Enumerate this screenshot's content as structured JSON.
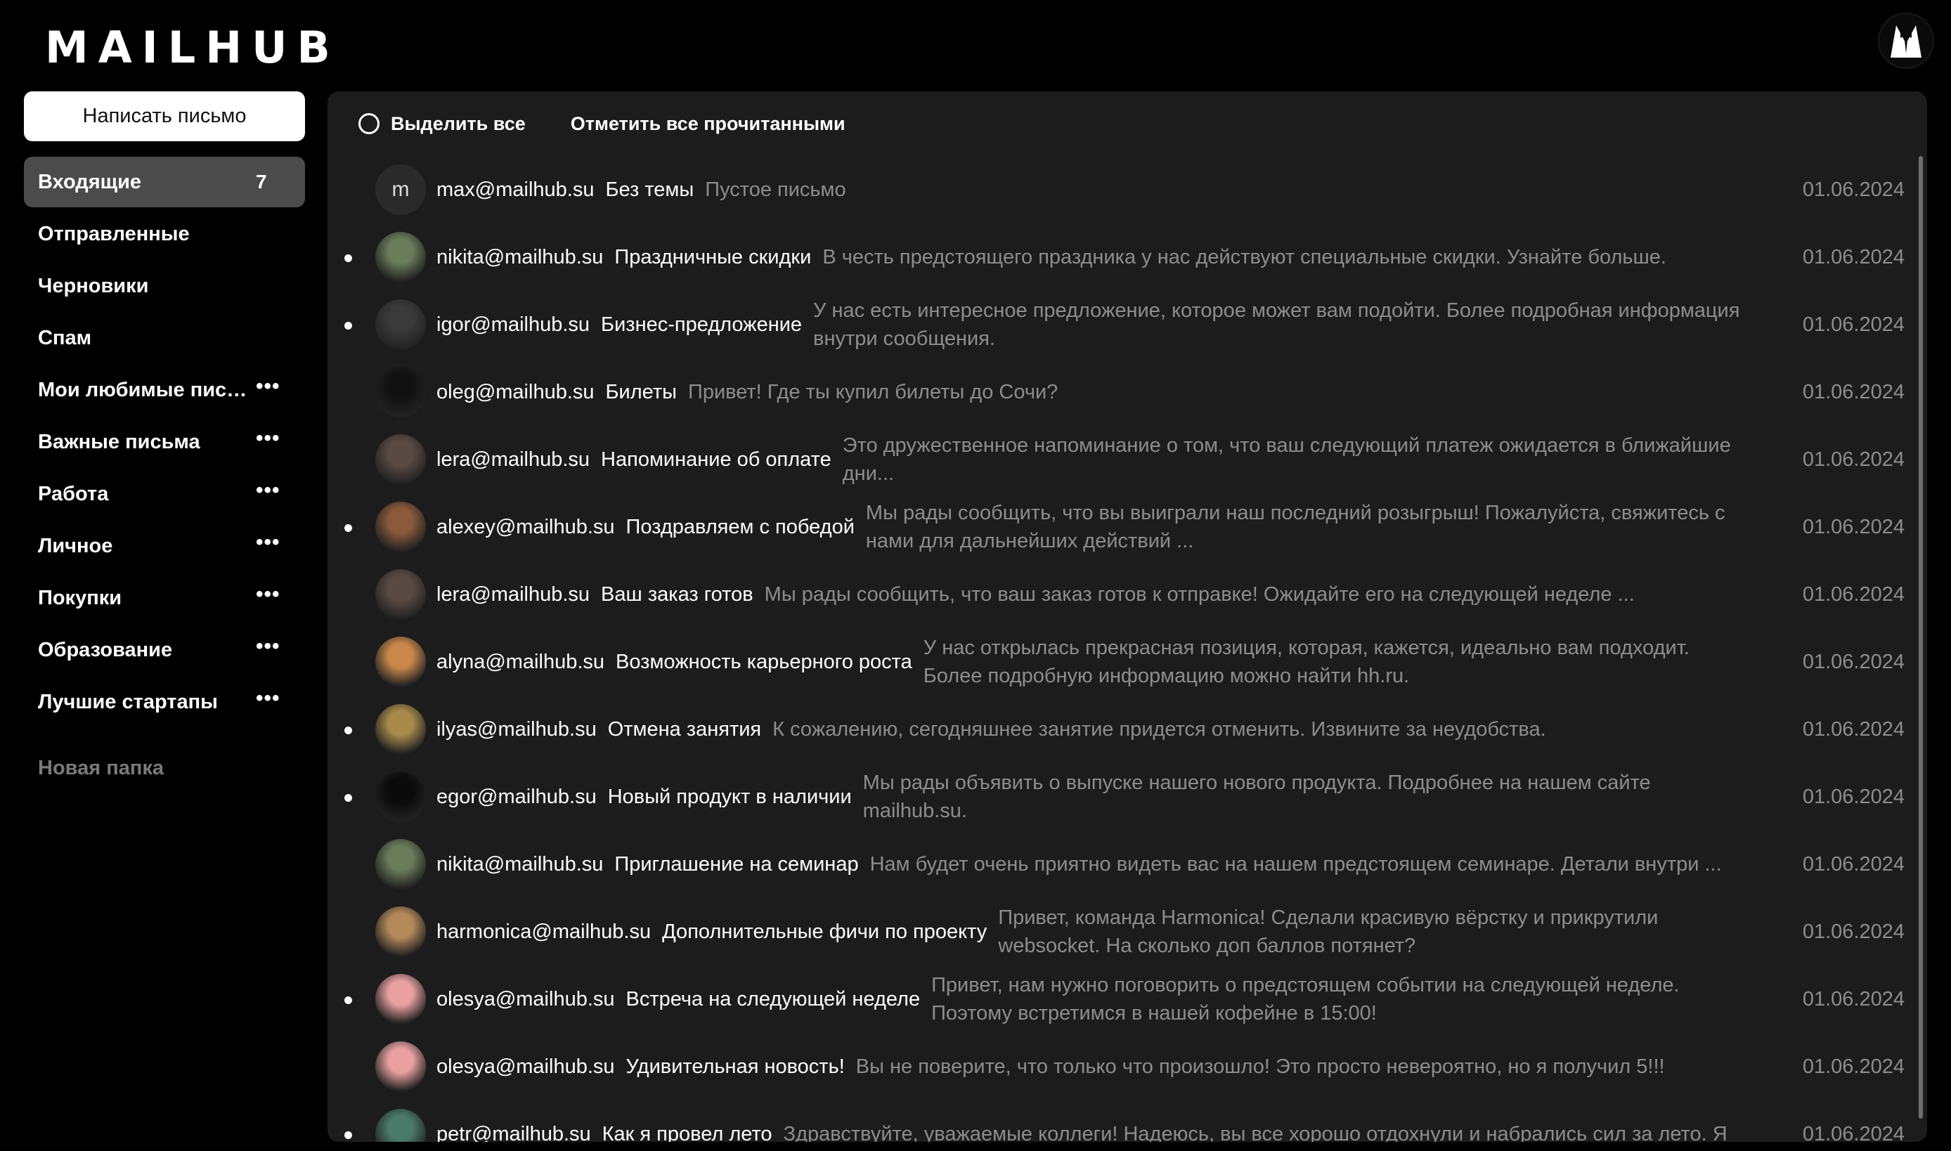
{
  "app": {
    "logo": "MAILHUB"
  },
  "sidebar": {
    "compose_label": "Написать письмо",
    "folders": [
      {
        "label": "Входящие",
        "count": "7"
      },
      {
        "label": "Отправленные"
      },
      {
        "label": "Черновики"
      },
      {
        "label": "Спам"
      },
      {
        "label": "Мои любимые пись...",
        "menu": "•••"
      },
      {
        "label": "Важные письма",
        "menu": "•••"
      },
      {
        "label": "Работа",
        "menu": "•••"
      },
      {
        "label": "Личное",
        "menu": "•••"
      },
      {
        "label": "Покупки",
        "menu": "•••"
      },
      {
        "label": "Образование",
        "menu": "•••"
      },
      {
        "label": "Лучшие стартапы",
        "menu": "•••"
      }
    ],
    "new_folder_label": "Новая папка"
  },
  "toolbar": {
    "select_all": "Выделить все",
    "mark_all_read": "Отметить все прочитанными"
  },
  "emails": [
    {
      "sender": "max@mailhub.su",
      "subject": "Без темы",
      "preview": "Пустое письмо",
      "date": "01.06.2024",
      "unread": false,
      "avatar_letter": "m",
      "avatar_color": "#2a2a2a"
    },
    {
      "sender": "nikita@mailhub.su",
      "subject": "Праздничные скидки",
      "preview": "В честь предстоящего праздника у нас действуют специальные скидки. Узнайте больше.",
      "date": "01.06.2024",
      "unread": true,
      "avatar_color": "#6b7c5a"
    },
    {
      "sender": "igor@mailhub.su",
      "subject": "Бизнес-предложение",
      "preview": "У нас есть интересное предложение, которое может вам подойти. Более подробная информация внутри сообщения.",
      "date": "01.06.2024",
      "unread": true,
      "avatar_color": "#3a3a3a"
    },
    {
      "sender": "oleg@mailhub.su",
      "subject": "Билеты",
      "preview": "Привет! Где ты купил билеты до Сочи?",
      "date": "01.06.2024",
      "unread": false,
      "avatar_color": "#111111"
    },
    {
      "sender": "lera@mailhub.su",
      "subject": "Напоминание об оплате",
      "preview": "Это дружественное напоминание о том, что ваш следующий платеж ожидается в ближайшие дни...",
      "date": "01.06.2024",
      "unread": false,
      "avatar_color": "#5a4a44"
    },
    {
      "sender": "alexey@mailhub.su",
      "subject": "Поздравляем с победой",
      "preview": "Мы рады сообщить, что вы выиграли наш последний розыгрыш! Пожалуйста, свяжитесь с нами для дальнейших действий ...",
      "date": "01.06.2024",
      "unread": true,
      "avatar_color": "#8a5a3a"
    },
    {
      "sender": "lera@mailhub.su",
      "subject": "Ваш заказ готов",
      "preview": "Мы рады сообщить, что ваш заказ готов к отправке! Ожидайте его на следующей неделе ...",
      "date": "01.06.2024",
      "unread": false,
      "avatar_color": "#5a4a44"
    },
    {
      "sender": "alyna@mailhub.su",
      "subject": "Возможность карьерного роста",
      "preview": "У нас открылась прекрасная позиция, которая, кажется, идеально вам подходит. Более подробную информацию можно найти hh.ru.",
      "date": "01.06.2024",
      "unread": false,
      "avatar_color": "#c9884a"
    },
    {
      "sender": "ilyas@mailhub.su",
      "subject": "Отмена занятия",
      "preview": "К сожалению, сегодняшнее занятие придется отменить. Извините за неудобства.",
      "date": "01.06.2024",
      "unread": true,
      "avatar_color": "#a88a4a"
    },
    {
      "sender": "egor@mailhub.su",
      "subject": "Новый продукт в наличии",
      "preview": "Мы рады объявить о выпуске нашего нового продукта. Подробнее на нашем сайте mailhub.su.",
      "date": "01.06.2024",
      "unread": true,
      "avatar_color": "#0a0a0a"
    },
    {
      "sender": "nikita@mailhub.su",
      "subject": "Приглашение на семинар",
      "preview": "Нам будет очень приятно видеть вас на нашем предстоящем семинаре. Детали внутри ...",
      "date": "01.06.2024",
      "unread": false,
      "avatar_color": "#6b7c5a"
    },
    {
      "sender": "harmonica@mailhub.su",
      "subject": "Дополнительные фичи по проекту",
      "preview": "Привет, команда Harmonica! Сделали красивую вёрстку и прикрутили websocket. На сколько доп баллов потянет?",
      "date": "01.06.2024",
      "unread": false,
      "avatar_color": "#b58a5a"
    },
    {
      "sender": "olesya@mailhub.su",
      "subject": "Встреча на следующей неделе",
      "preview": "Привет, нам нужно поговорить о предстоящем событии на следующей неделе. Поэтому встретимся в нашей кофейне в 15:00!",
      "date": "01.06.2024",
      "unread": true,
      "avatar_color": "#e8a0a0"
    },
    {
      "sender": "olesya@mailhub.su",
      "subject": "Удивительная новость!",
      "preview": "Вы не поверите, что только что произошло! Это просто невероятно, но я получил 5!!!",
      "date": "01.06.2024",
      "unread": false,
      "avatar_color": "#e8a0a0"
    },
    {
      "sender": "petr@mailhub.su",
      "subject": "Как я провел лето",
      "preview": "Здравствуйте, уважаемые коллеги! Надеюсь, вы все хорошо отдохнули и набрались сил за лето. Я",
      "date": "01.06.2024",
      "unread": true,
      "avatar_color": "#4a7a6a"
    }
  ]
}
